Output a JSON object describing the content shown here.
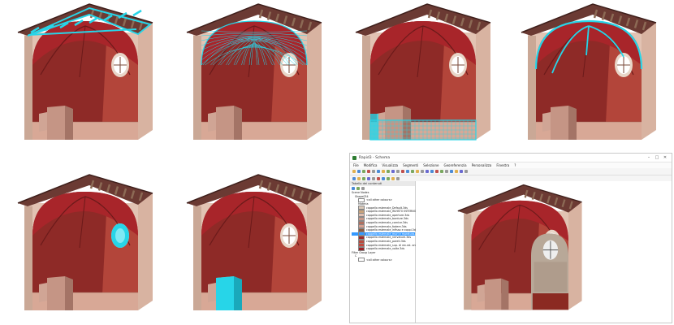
{
  "panels": [
    {
      "id": "p1",
      "highlight": "roof-beams"
    },
    {
      "id": "p2",
      "highlight": "vault-mesh"
    },
    {
      "id": "p3",
      "highlight": "lower-walls"
    },
    {
      "id": "p4",
      "highlight": "vault-ribs"
    },
    {
      "id": "p5",
      "highlight": "window"
    },
    {
      "id": "p6",
      "highlight": "door"
    }
  ],
  "colors": {
    "highlight": "#27d5e8",
    "roof": "#6b3a33",
    "vault": "#a8252a",
    "wall": "#b3453a",
    "exterior": "#d8b3a1",
    "floor": "#d8a896"
  },
  "app": {
    "title": "Rapid3 - Schema",
    "menu": [
      "File",
      "Modifica",
      "Visualizza",
      "Segmenti",
      "Selezione",
      "Georeferenzia",
      "Personalizza",
      "Finestra",
      "?"
    ],
    "panel_title": "Tabella dei contenuti",
    "tree": [
      {
        "label": "Scene Nodes",
        "indent": 0,
        "color": ""
      },
      {
        "label": "Shape034",
        "indent": 1,
        "color": ""
      },
      {
        "label": "<all other colours>",
        "indent": 2,
        "color": "#ffffff"
      },
      {
        "label": "Materia",
        "indent": 2,
        "color": ""
      },
      {
        "label": "cappella esternale_Default.3ds",
        "indent": 2,
        "color": "#d9c8b8"
      },
      {
        "label": "cappella esternale_INVISTO INTERNO.3ds",
        "indent": 2,
        "color": "#c8a27a"
      },
      {
        "label": "cappella esternale_aperture.3ds",
        "indent": 2,
        "color": "#e0bfb0"
      },
      {
        "label": "cappella esternale_bordure.3ds",
        "indent": 2,
        "color": "#c99a8a"
      },
      {
        "label": "cappella esternale_cornice.3ds",
        "indent": 2,
        "color": "#b07060"
      },
      {
        "label": "cappella esternale_fodere.3ds",
        "indent": 2,
        "color": "#d6a090"
      },
      {
        "label": "cappella esternale_infisso e coppi.3ds",
        "indent": 2,
        "color": "#8b5a40"
      },
      {
        "label": "cappella esternale_muri e muratura.3ds",
        "indent": 2,
        "color": "#3399ff"
      },
      {
        "label": "cappella esternale_nervature.3ds",
        "indent": 2,
        "color": "#a02828"
      },
      {
        "label": "cappella esternale_pareti.3ds",
        "indent": 2,
        "color": "#b94a3c"
      },
      {
        "label": "cappella esternale_sup. di rec.ed. anteriore.3ds",
        "indent": 2,
        "color": "#c4483c"
      },
      {
        "label": "cappella esternale_volte.3ds",
        "indent": 2,
        "color": "#9e2227"
      },
      {
        "label": "Filter Group Layer",
        "indent": 0,
        "color": ""
      },
      {
        "label": "C",
        "indent": 1,
        "color": ""
      },
      {
        "label": "<all other colours>",
        "indent": 2,
        "color": "#ffffff"
      }
    ],
    "selected_index": 11
  }
}
